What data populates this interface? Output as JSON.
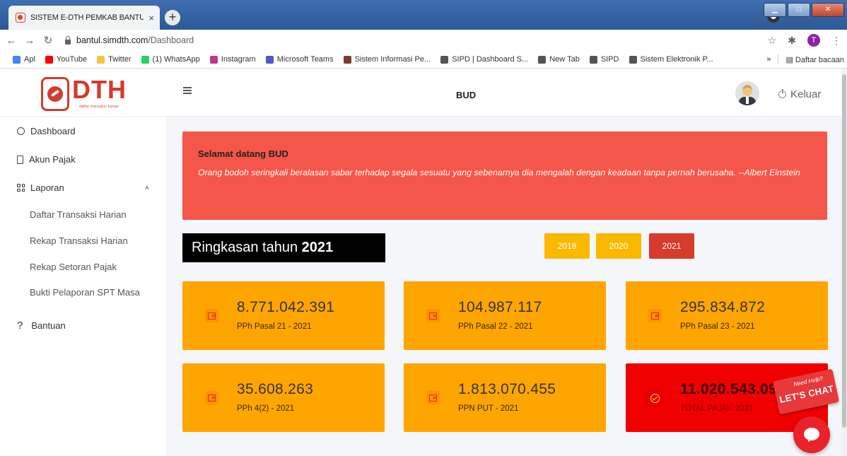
{
  "browser": {
    "tab_title": "SISTEM E-DTH PEMKAB BANTUL",
    "tab_close": "×",
    "new_tab": "+",
    "url_domain": "bantul.simdth.com",
    "url_path": "/Dashboard",
    "profile_initial": "T",
    "bookmarks": [
      {
        "label": "Apl",
        "color": "#4285f4"
      },
      {
        "label": "YouTube",
        "color": "#ff0000"
      },
      {
        "label": "Twitter",
        "color": "#f4c542"
      },
      {
        "label": "(1) WhatsApp",
        "color": "#25d366"
      },
      {
        "label": "Instagram",
        "color": "#c13584"
      },
      {
        "label": "Microsoft Teams",
        "color": "#5059c9"
      },
      {
        "label": "Sistem Informasi Pe...",
        "color": "#7a3e2e"
      },
      {
        "label": "SIPD | Dashboard S...",
        "color": "#555555"
      },
      {
        "label": "New Tab",
        "color": "#555555"
      },
      {
        "label": "SIPD",
        "color": "#555555"
      },
      {
        "label": "Sistem Elektronik P...",
        "color": "#555555"
      }
    ],
    "bookmarks_more": "»",
    "reading_list": "Daftar bacaan"
  },
  "sidebar": {
    "logo_text": "DTH",
    "logo_subtitle": "daftar transaksi harian",
    "items": [
      {
        "label": "Dashboard",
        "icon": "clock-icon"
      },
      {
        "label": "Akun Pajak",
        "icon": "book-icon"
      },
      {
        "label": "Laporan",
        "icon": "grid-icon"
      }
    ],
    "laporan_chevron": "˄",
    "subitems": [
      "Daftar Transaksi Harian",
      "Rekap Transaksi Harian",
      "Rekap Setoran Pajak",
      "Bukti Pelaporan SPT Masa"
    ],
    "help": {
      "icon_text": "?",
      "label": "Bantuan"
    }
  },
  "header": {
    "title": "BUD",
    "logout_label": "Keluar"
  },
  "welcome": {
    "title": "Selamat datang BUD",
    "quote": "Orang bodoh seringkali beralasan sabar terhadap segala sesuatu yang sebenarnya dia mengalah dengan keadaan tanpa pernah berusaha. --Albert Einstein"
  },
  "summary": {
    "label_prefix": "Ringkasan tahun",
    "year": "2021",
    "year_buttons": [
      "2019",
      "2020",
      "2021"
    ],
    "active_year": "2021",
    "cards": [
      {
        "value": "8.771.042.391",
        "label": "PPh Pasal 21 - 2021"
      },
      {
        "value": "104.987.117",
        "label": "PPh Pasal 22 - 2021"
      },
      {
        "value": "295.834.872",
        "label": "PPh Pasal 23 - 2021"
      },
      {
        "value": "35.608.263",
        "label": "PPh 4(2) - 2021"
      },
      {
        "value": "1.813.070.455",
        "label": "PPN PUT - 2021"
      },
      {
        "value": "11.020.543.098",
        "label": "TOTAL PAJAK 2021"
      }
    ]
  },
  "chat": {
    "need_help": "Need Help?",
    "lets_chat": "LET'S CHAT"
  },
  "colors": {
    "brand_red": "#d33b2c",
    "welcome_bg": "#f5564a",
    "card_orange": "#ffa500",
    "card_total": "#f00000",
    "year_button": "#fbb800"
  }
}
